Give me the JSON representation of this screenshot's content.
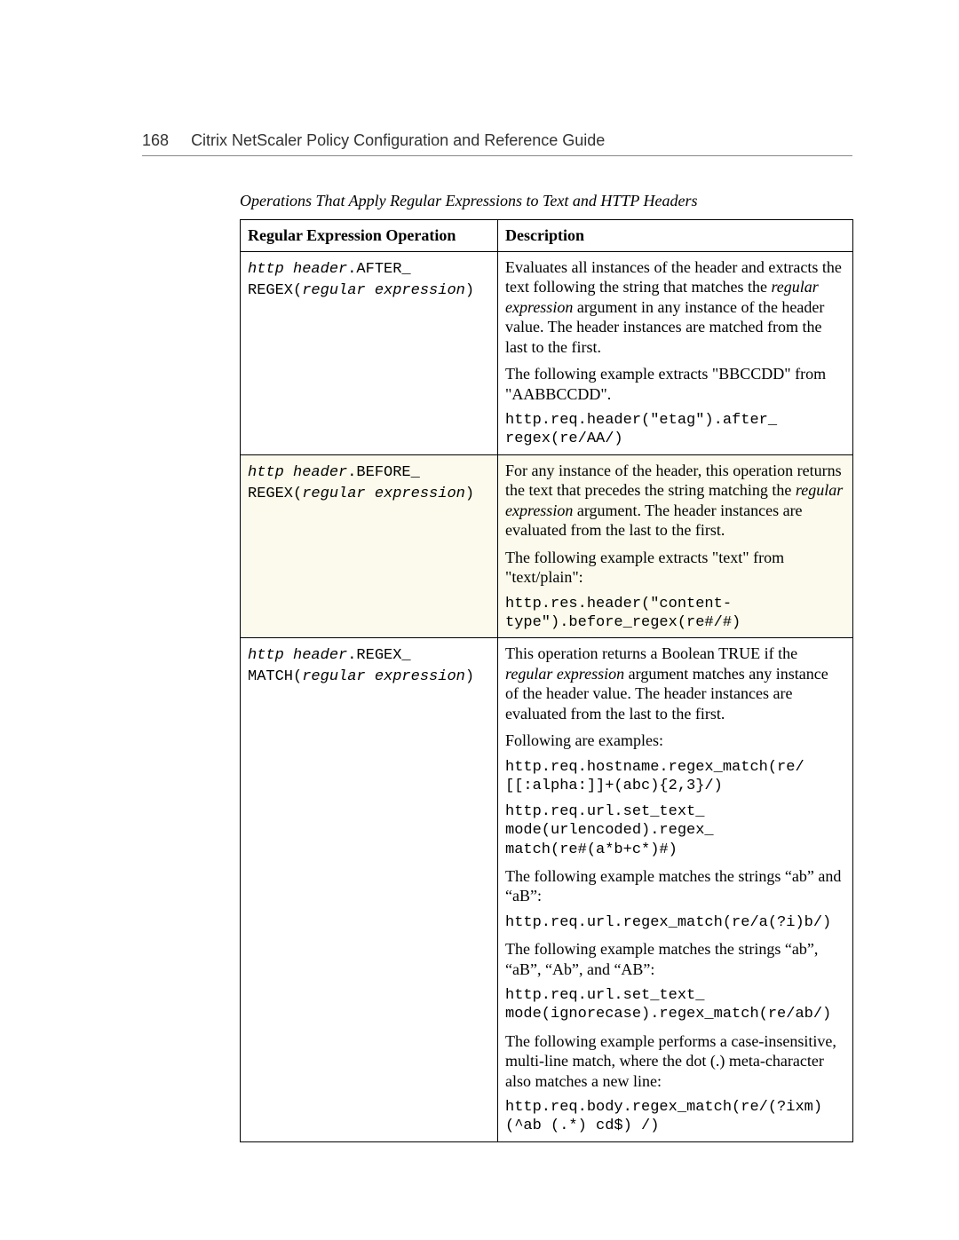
{
  "header": {
    "page_number": "168",
    "title": "Citrix NetScaler Policy Configuration and Reference Guide"
  },
  "table": {
    "caption": "Operations That Apply Regular Expressions to Text and HTTP Headers",
    "col_op": "Regular Expression Operation",
    "col_desc": "Description"
  },
  "r1": {
    "op_a": "http header",
    "op_b": ".AFTER_\nREGEX(",
    "op_c": "regular expression",
    "op_d": ")",
    "d1a": "Evaluates all instances of the header and extracts the text following the string that matches the ",
    "d1b": "regular expression",
    "d1c": " argument in any instance of the header value. The header instances are matched from the last to the first.",
    "d2": "The following example extracts \"BBCCDD\" from \"AABBCCDD\".",
    "d3": "http.req.header(\"etag\").after_\nregex(re/AA/)"
  },
  "r2": {
    "op_a": "http header",
    "op_b": ".BEFORE_\nREGEX(",
    "op_c": "regular expression",
    "op_d": ")",
    "d1a": "For any instance of the header, this operation returns the text that precedes the string matching the ",
    "d1b": "regular expression",
    "d1c": " argument. The header instances are evaluated from the last to the first.",
    "d2": "The following example extracts \"text\" from \"text/plain\":",
    "d3": "http.res.header(\"content-\ntype\").before_regex(re#/#)"
  },
  "r3": {
    "op_a": "http header",
    "op_b": ".REGEX_\nMATCH(",
    "op_c": "regular expression",
    "op_d": ")",
    "d1a": "This operation returns a Boolean TRUE if the ",
    "d1b": "regular expression",
    "d1c": " argument matches any instance of the header value. The header instances are evaluated from the last to the first.",
    "d2": "Following are examples:",
    "d3": "http.req.hostname.regex_match(re/\n[[:alpha:]]+(abc){2,3}/)",
    "d4": "http.req.url.set_text_\nmode(urlencoded).regex_\nmatch(re#(a*b+c*)#)",
    "d5": "The following example matches the strings “ab” and “aB”:",
    "d6": "http.req.url.regex_match(re/a(?i)b/)",
    "d7": "The following example matches the strings “ab”, “aB”, “Ab”, and “AB”:",
    "d8": "http.req.url.set_text_\nmode(ignorecase).regex_match(re/ab/)",
    "d9": "The following example performs a case-insensitive, multi-line match, where the dot (.) meta-character also matches a new line:",
    "d10": "http.req.body.regex_match(re/(?ixm)\n(^ab (.*) cd$) /)"
  }
}
